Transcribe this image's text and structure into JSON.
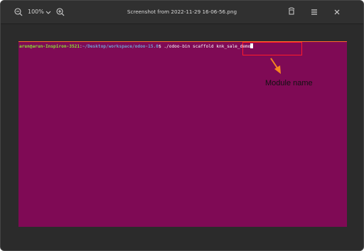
{
  "window": {
    "title": "Screenshot from 2022-11-29 16-06-56.png",
    "zoom_level": "100%"
  },
  "icons": {
    "zoom_out": "zoom-out-icon",
    "zoom_menu": "chevron-down-icon",
    "zoom_in": "zoom-in-icon",
    "rotate": "rotate-icon",
    "menu": "hamburger-menu-icon",
    "close": "close-icon"
  },
  "terminal": {
    "user_host": "arun@arun-Inspiron-3521",
    "separator": ":",
    "path": "~/Desktop/workspace/odoo-15.0",
    "prompt_symbol": "$ ",
    "command": "./odoo-bin scaffold knk_sale_demo",
    "background_color": "#7f0a55",
    "user_color": "#8ae234",
    "path_color": "#729fcf"
  },
  "annotation": {
    "label": "Module name",
    "box_color": "#ff1a2a",
    "arrow_color": "#f5861f"
  }
}
